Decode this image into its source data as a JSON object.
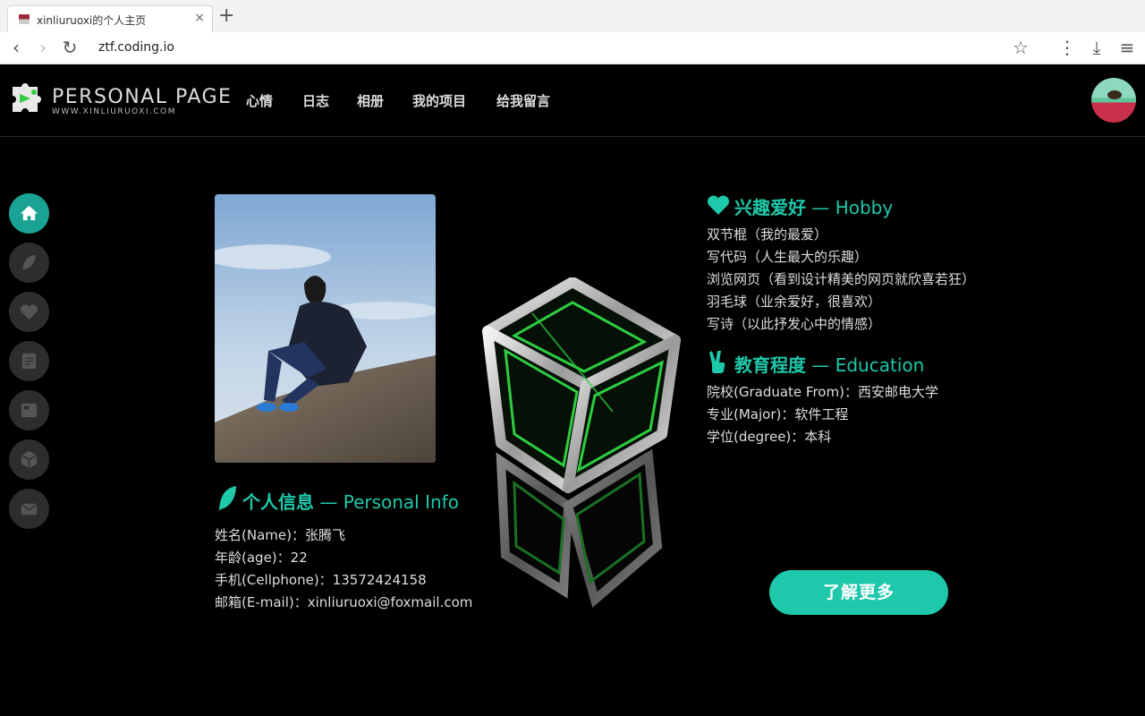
{
  "browser": {
    "tab_title": "xinliuruoxi的个人主页",
    "tab_close": "×",
    "new_tab": "+",
    "url": "ztf.coding.io"
  },
  "header": {
    "logo_title": "PERSONAL PAGE",
    "logo_subtitle": "WWW.XINLIURUOXI.COM",
    "nav": [
      "心情",
      "日志",
      "相册",
      "我的项目",
      "给我留言"
    ]
  },
  "rail": {
    "items": [
      "home-icon",
      "feather-icon",
      "heart-icon",
      "notes-icon",
      "photo-icon",
      "cube-icon",
      "mail-icon"
    ],
    "active_index": 0,
    "accent": "#1aa394"
  },
  "personal": {
    "title_cn": "个人信息",
    "title_en": " — Personal Info",
    "lines": [
      "姓名(Name)：张腾飞",
      "年龄(age)：22",
      "手机(Cellphone)：13572424158",
      "邮箱(E-mail)：xinliuruoxi@foxmail.com"
    ]
  },
  "hobby": {
    "title_cn": "兴趣爱好",
    "title_en": " — Hobby",
    "lines": [
      "双节棍（我的最爱）",
      "写代码（人生最大的乐趣）",
      "浏览网页（看到设计精美的网页就欣喜若狂）",
      "羽毛球（业余爱好，很喜欢）",
      "写诗（以此抒发心中的情感）"
    ]
  },
  "education": {
    "title_cn": "教育程度",
    "title_en": " — Education",
    "lines": [
      "院校(Graduate From)：西安邮电大学",
      "专业(Major)：软件工程",
      "学位(degree)：本科"
    ]
  },
  "more_button": "了解更多",
  "colors": {
    "accent": "#1ec8aa",
    "background": "#000000"
  }
}
